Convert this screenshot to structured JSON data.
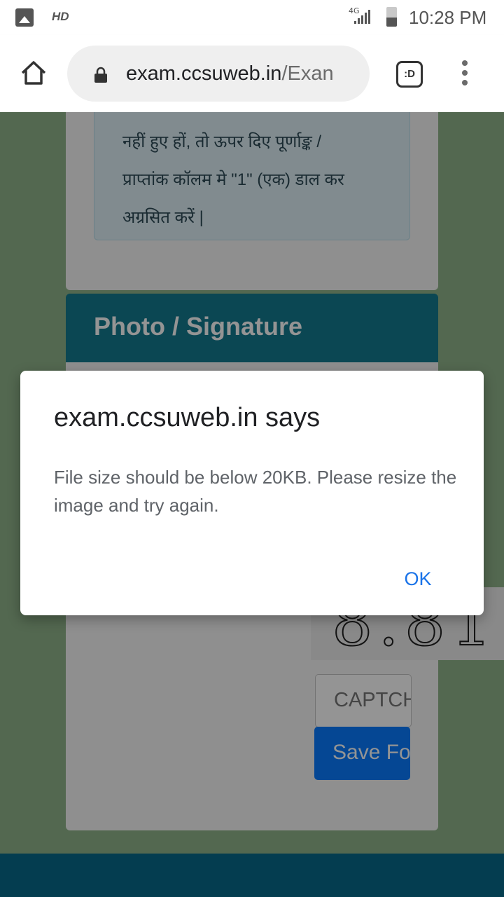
{
  "status_bar": {
    "hd_label": "HD",
    "network": "4G",
    "time": "10:28 PM"
  },
  "browser": {
    "url_domain": "exam.ccsuweb.in",
    "url_path": "/Exan",
    "tab_label": ":D"
  },
  "page": {
    "notice_text": "नहीं हुए हों, तो ऊपर दिए पूर्णाङ्क /\nप्राप्तांक कॉलम मे \"1\" (एक) डाल कर\nअग्रसित करें |",
    "section_title": "Photo / Signature",
    "captcha_placeholder": "CAPTCHA",
    "captcha_text": "8.81",
    "save_button_label": "Save Form"
  },
  "dialog": {
    "title": "exam.ccsuweb.in says",
    "message": "File size should be below 20KB. Please resize the image and try again.",
    "ok_label": "OK"
  }
}
